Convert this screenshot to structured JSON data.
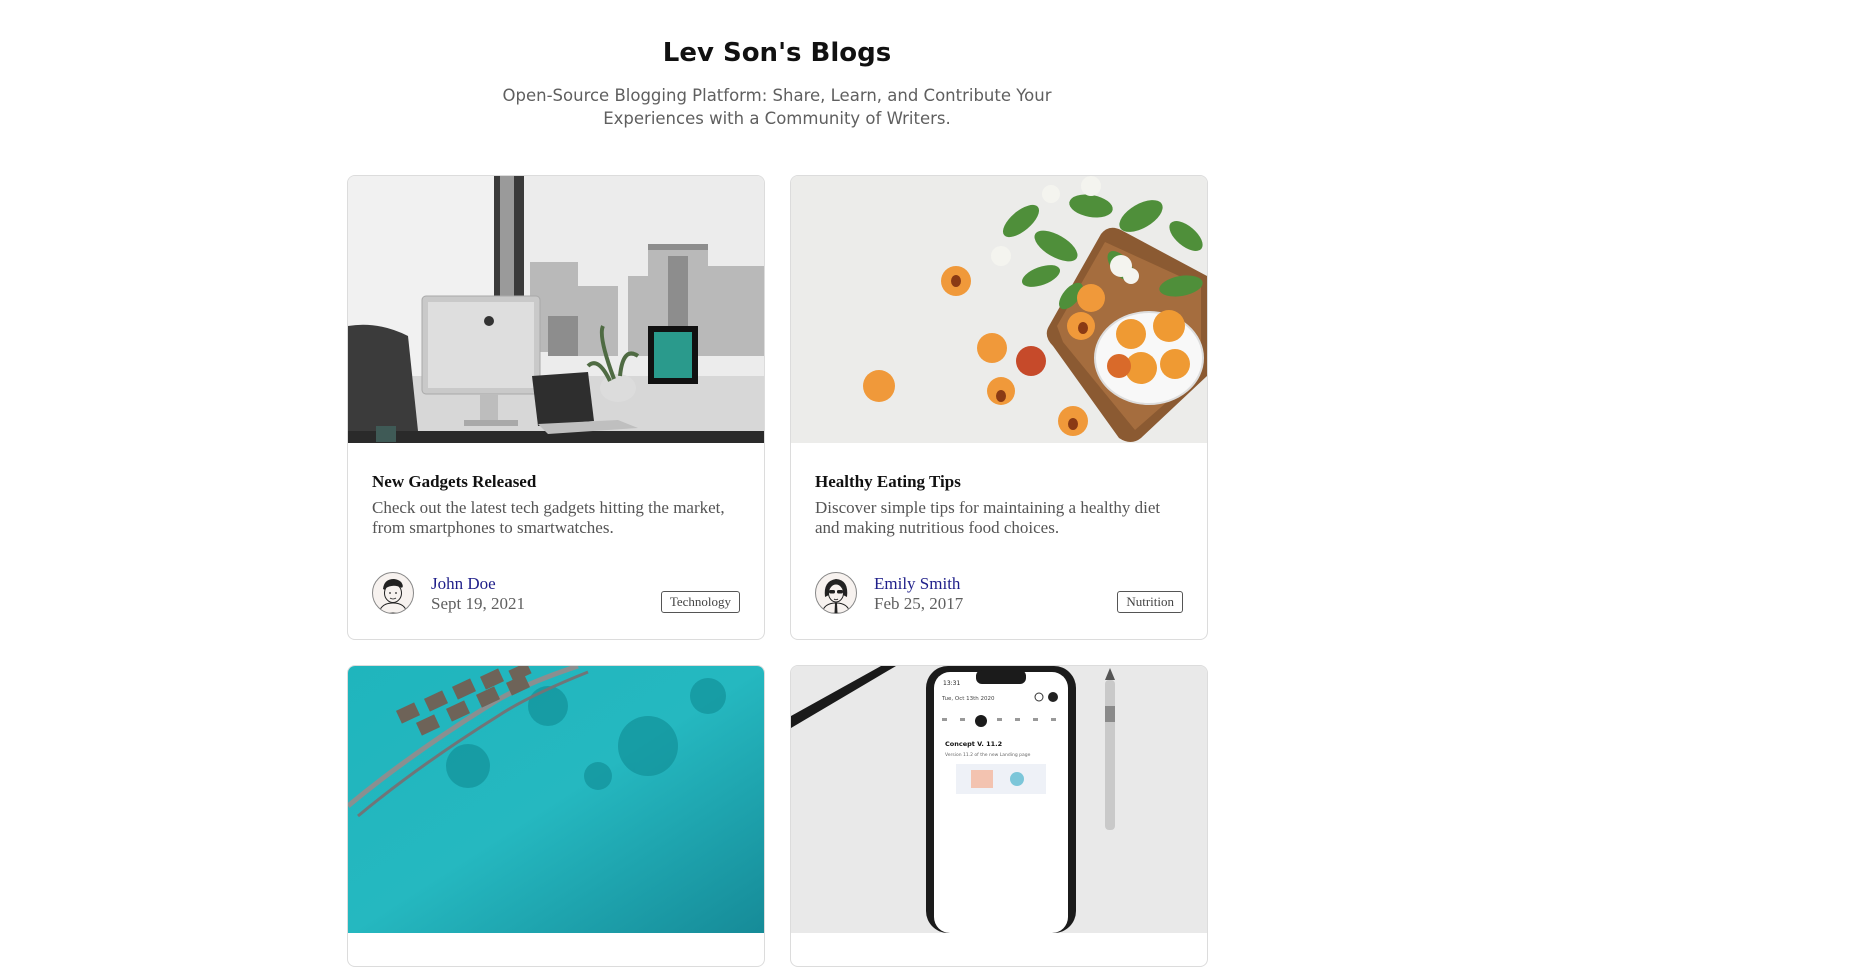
{
  "header": {
    "title": "Lev Son's Blogs",
    "subtitle": "Open-Source Blogging Platform: Share, Learn, and Contribute Your Experiences with a Community of Writers."
  },
  "posts": [
    {
      "image": "office-desk-photo",
      "title": "New Gadgets Released",
      "description": "Check out the latest tech gadgets hitting the market, from smartphones to smartwatches.",
      "author": "John Doe",
      "date": "Sept 19, 2021",
      "tag": "Technology"
    },
    {
      "image": "apricots-photo",
      "title": "Healthy Eating Tips",
      "description": "Discover simple tips for maintaining a healthy diet and making nutritious food choices.",
      "author": "Emily Smith",
      "date": "Feb 25, 2017",
      "tag": "Nutrition"
    },
    {
      "image": "overwater-bungalows-photo"
    },
    {
      "image": "smartphone-photo",
      "phone_time": "13:31",
      "phone_date": "Tue, Oct 13th 2020",
      "phone_heading": "Concept V. 11.2",
      "phone_subtext": "Version 11.2 of the new Landing page"
    }
  ],
  "colors": {
    "author_link": "#1f1f8a",
    "card_border": "#dcdcdc",
    "muted_text": "#5f5f5f"
  }
}
